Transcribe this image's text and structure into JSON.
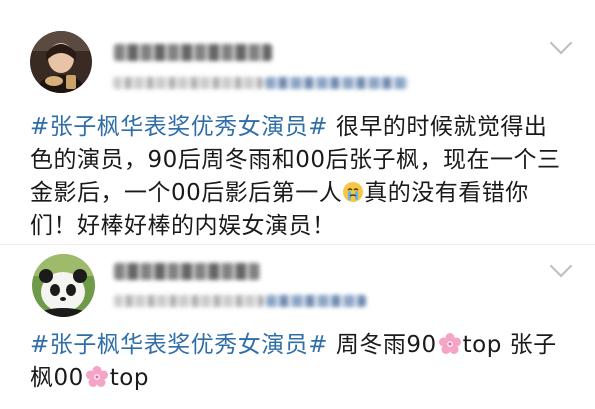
{
  "comments": [
    {
      "topic": "#张子枫华表奖优秀女演员#",
      "text_part1": " 很早的时候就觉得出色的演员，90后周冬雨和00后张子枫，现在一个三金影后，一个00后影后第一人",
      "emoji": "crying-face-icon",
      "text_part2": "真的没有看错你们！好棒好棒的内娱女演员！"
    },
    {
      "topic": "#张子枫华表奖优秀女演员#",
      "text_part1": " 周冬雨90",
      "emoji1": "cherry-blossom-icon",
      "text_part2": "top 张子枫00",
      "emoji2": "cherry-blossom-icon",
      "text_part3": "top"
    }
  ],
  "colors": {
    "topic": "#2f6ea8",
    "text": "#1a1a1a",
    "chevron": "#bdbdbd"
  }
}
